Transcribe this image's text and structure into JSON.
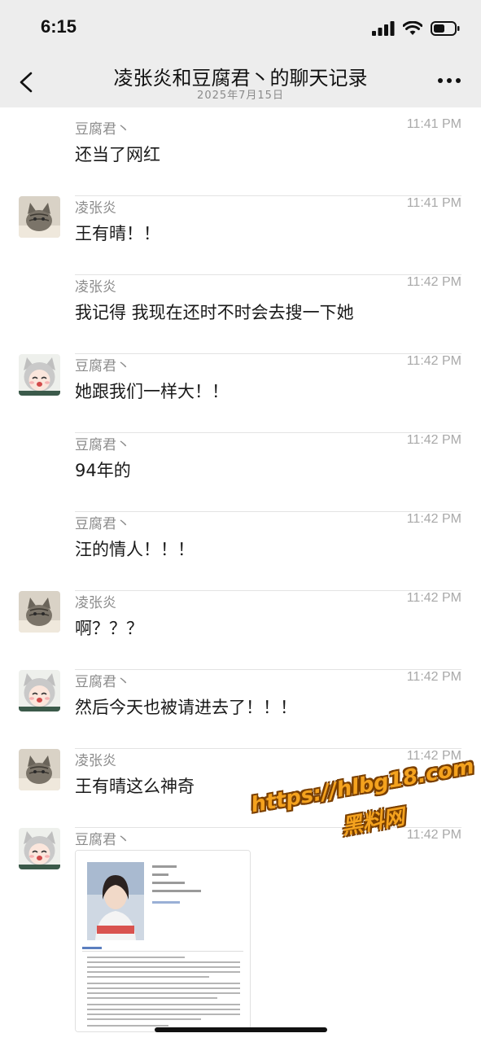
{
  "status_bar": {
    "time": "6:15"
  },
  "nav": {
    "title": "凌张炎和豆腐君丶的聊天记录",
    "subtitle": "2025年7月15日"
  },
  "messages": [
    {
      "sender": "豆腐君丶",
      "time": "11:41 PM",
      "text": "还当了网红",
      "avatar": "none"
    },
    {
      "sender": "凌张炎",
      "time": "11:41 PM",
      "text": "王有晴！！",
      "avatar": "cat"
    },
    {
      "sender": "凌张炎",
      "time": "11:42 PM",
      "text": "我记得 我现在还时不时会去搜一下她",
      "avatar": "none"
    },
    {
      "sender": "豆腐君丶",
      "time": "11:42 PM",
      "text": "她跟我们一样大！！",
      "avatar": "anime"
    },
    {
      "sender": "豆腐君丶",
      "time": "11:42 PM",
      "text": "94年的",
      "avatar": "none"
    },
    {
      "sender": "豆腐君丶",
      "time": "11:42 PM",
      "text": "汪的情人！！！",
      "avatar": "none"
    },
    {
      "sender": "凌张炎",
      "time": "11:42 PM",
      "text": "啊？？？",
      "avatar": "cat"
    },
    {
      "sender": "豆腐君丶",
      "time": "11:42 PM",
      "text": "然后今天也被请进去了！！！",
      "avatar": "anime"
    },
    {
      "sender": "凌张炎",
      "time": "11:42 PM",
      "text": "王有晴这么神奇",
      "avatar": "cat"
    },
    {
      "sender": "豆腐君丶",
      "time": "11:42 PM",
      "text": "",
      "avatar": "anime",
      "attachment": "image"
    }
  ],
  "watermark": {
    "url": "https://hlbg18.com",
    "name": "黑料网"
  },
  "colors": {
    "header_bg": "#ededed",
    "watermark": "#f4a21e"
  }
}
